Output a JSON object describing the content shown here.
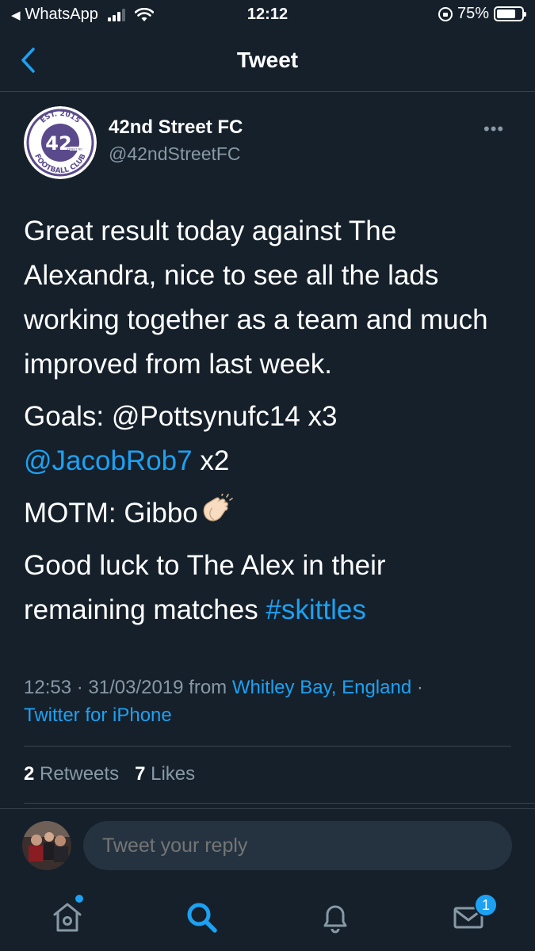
{
  "status_bar": {
    "back_app": "WhatsApp",
    "time": "12:12",
    "battery_percent": "75%",
    "battery_level": 0.75
  },
  "nav": {
    "title": "Tweet",
    "back_icon": "chevron-left-icon"
  },
  "author": {
    "name": "42nd Street FC",
    "handle": "@42ndStreetFC",
    "logo": {
      "number": "42",
      "top_text": "EST. 2015",
      "bottom_text": "FOOTBALL CLUB",
      "tag": "STREET ND"
    },
    "more_icon": "ellipsis-icon"
  },
  "tweet": {
    "para1": "Great result today against The Alexandra, nice to see all the lads working together as a team and much improved from last week.",
    "goals_prefix": "Goals: @Pottsynufc14 x3",
    "goals_link": "@JacobRob7",
    "goals_suffix": " x2",
    "motm": "MOTM: Gibbo",
    "luck_text": "Good luck to The Alex in their remaining matches ",
    "hashtag": "#skittles"
  },
  "meta": {
    "timestamp": "12:53 · 31/03/2019 from ",
    "location": "Whitley Bay, England",
    "separator": " ·",
    "source": "Twitter for iPhone"
  },
  "stats": {
    "retweets_count": "2",
    "retweets_label": " Retweets",
    "likes_count": "7",
    "likes_label": " Likes"
  },
  "reply": {
    "placeholder": "Tweet your reply"
  },
  "tabbar": {
    "items": [
      "home-icon",
      "search-icon",
      "notifications-icon",
      "messages-icon"
    ],
    "messages_badge": "1"
  },
  "colors": {
    "background": "#15202b",
    "accent": "#1da1f2",
    "secondary_text": "#8899a6",
    "logo_purple": "#5b4a8b"
  }
}
